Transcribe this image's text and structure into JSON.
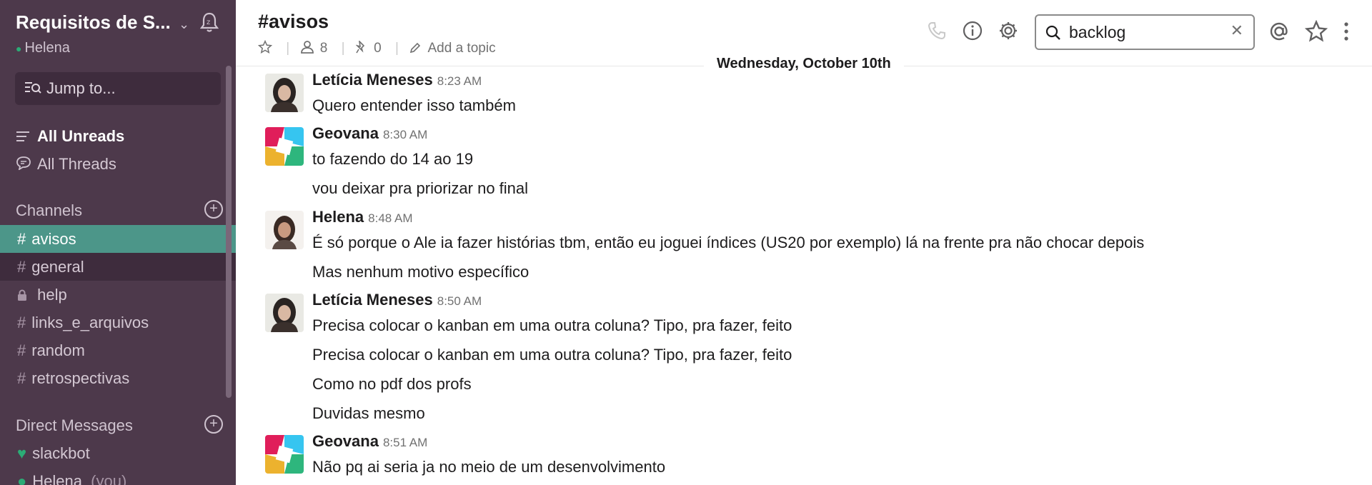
{
  "workspace": {
    "name": "Requisitos de S...",
    "user": "Helena"
  },
  "jump": {
    "label": "Jump to..."
  },
  "nav": {
    "all_unreads": "All Unreads",
    "all_threads": "All Threads"
  },
  "channels": {
    "heading": "Channels",
    "items": [
      {
        "name": "avisos",
        "prefix": "#"
      },
      {
        "name": "general",
        "prefix": "#"
      },
      {
        "name": "help",
        "prefix": "lock"
      },
      {
        "name": "links_e_arquivos",
        "prefix": "#"
      },
      {
        "name": "random",
        "prefix": "#"
      },
      {
        "name": "retrospectivas",
        "prefix": "#"
      }
    ]
  },
  "dms": {
    "heading": "Direct Messages",
    "items": [
      {
        "name": "slackbot",
        "icon": "heart-icon"
      },
      {
        "name": "Helena",
        "suffix": "(you)"
      }
    ]
  },
  "header": {
    "channel": "#avisos",
    "members": "8",
    "pins": "0",
    "topic": "Add a topic"
  },
  "search": {
    "value": "backlog"
  },
  "date_divider": "Wednesday, October 10th",
  "messages": [
    {
      "author": "Letícia Meneses",
      "time": "8:23 AM",
      "lines": [
        "Quero entender isso também"
      ]
    },
    {
      "author": "Geovana",
      "time": "8:30 AM",
      "lines": [
        "to fazendo do 14 ao 19",
        "vou deixar pra priorizar no final"
      ]
    },
    {
      "author": "Helena",
      "time": "8:48 AM",
      "lines": [
        "É só porque o Ale ia fazer histórias tbm, então eu joguei índices (US20 por exemplo) lá na frente pra não chocar depois",
        "Mas nenhum motivo específico"
      ]
    },
    {
      "author": "Letícia Meneses",
      "time": "8:50 AM",
      "lines": [
        "Precisa colocar o kanban em uma outra coluna? Tipo, pra fazer,  feito",
        "Precisa colocar o kanban em uma outra coluna? Tipo, pra fazer,  feito",
        "Como no pdf dos profs",
        "Duvidas mesmo"
      ]
    },
    {
      "author": "Geovana",
      "time": "8:51 AM",
      "lines": [
        "Não pq ai seria ja no meio de um desenvolvimento"
      ]
    }
  ],
  "colors": {
    "sidebar_bg": "#4d394b",
    "active_channel": "#4c9689",
    "presence": "#2bac76"
  }
}
